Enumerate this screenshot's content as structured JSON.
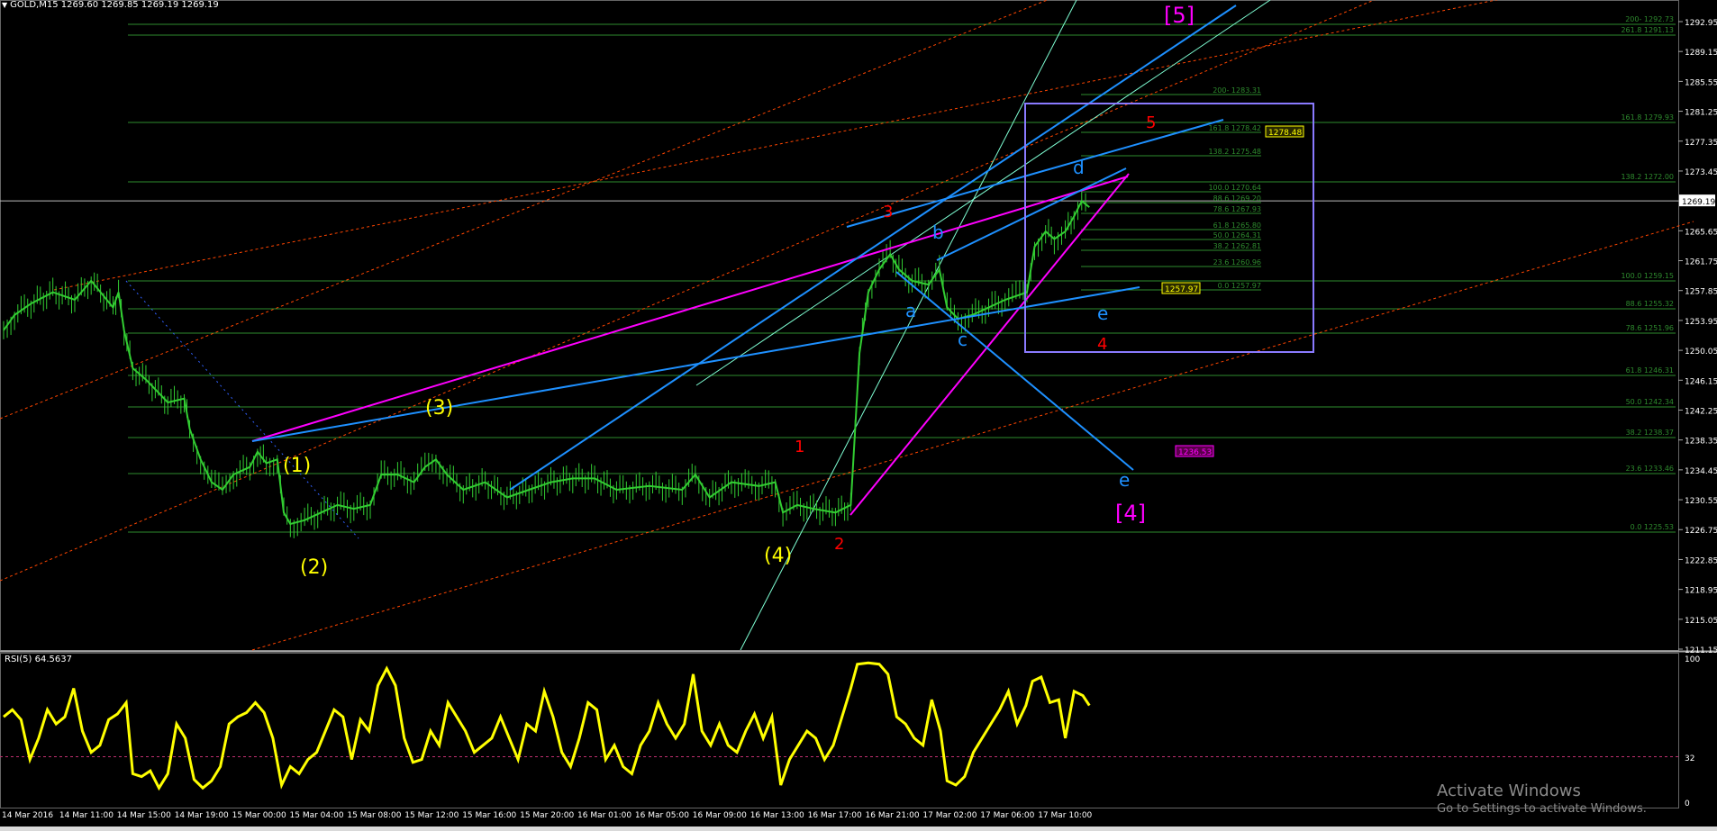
{
  "header": {
    "symbol": "GOLD,M15",
    "ohlc": "1269.60 1269.85 1269.19 1269.19"
  },
  "rsi_header": "RSI(5) 64.5637",
  "watermark": {
    "line1": "Activate Windows",
    "line2": "Go to Settings to activate Windows."
  },
  "colors": {
    "background": "#000000",
    "candles": "#32cd32",
    "rsi_line": "#ffff00",
    "fib_lines": "#2e8b2e",
    "trend_blue": "#1e90ff",
    "trend_magenta": "#ff00ff",
    "channel_red": "#ff4500",
    "channel_cyan": "#7fffd4",
    "box": "#8a7aff"
  },
  "chart_data": [
    {
      "type": "candlestick",
      "instrument": "GOLD",
      "timeframe": "M15",
      "current_price": 1269.19,
      "current_price_label": "1269.19",
      "y_ticks": [
        "1292.95",
        "1289.15",
        "1285.55",
        "1281.25",
        "1277.35",
        "1273.45",
        "1269.19",
        "1265.65",
        "1261.75",
        "1257.85",
        "1253.95",
        "1250.05",
        "1246.15",
        "1242.25",
        "1238.35",
        "1234.45",
        "1230.55",
        "1226.75",
        "1222.85",
        "1218.95",
        "1215.05",
        "1211.15"
      ],
      "x_ticks": [
        "14 Mar 2016",
        "14 Mar 11:00",
        "14 Mar 15:00",
        "14 Mar 19:00",
        "15 Mar 00:00",
        "15 Mar 04:00",
        "15 Mar 08:00",
        "15 Mar 12:00",
        "15 Mar 16:00",
        "15 Mar 20:00",
        "16 Mar 01:00",
        "16 Mar 05:00",
        "16 Mar 09:00",
        "16 Mar 13:00",
        "16 Mar 17:00",
        "16 Mar 21:00",
        "17 Mar 02:00",
        "17 Mar 06:00",
        "17 Mar 10:00"
      ],
      "price_path": [
        [
          0,
          1253
        ],
        [
          10,
          1255
        ],
        [
          25,
          1256.5
        ],
        [
          45,
          1258
        ],
        [
          65,
          1257
        ],
        [
          80,
          1259.5
        ],
        [
          100,
          1256
        ],
        [
          105,
          1258
        ],
        [
          110,
          1253
        ],
        [
          118,
          1248
        ],
        [
          130,
          1246.5
        ],
        [
          150,
          1243.5
        ],
        [
          165,
          1244
        ],
        [
          170,
          1240
        ],
        [
          180,
          1236
        ],
        [
          190,
          1233
        ],
        [
          200,
          1232
        ],
        [
          210,
          1234
        ],
        [
          225,
          1235
        ],
        [
          232,
          1237
        ],
        [
          240,
          1235.5
        ],
        [
          250,
          1236
        ],
        [
          256,
          1229
        ],
        [
          262,
          1227.5
        ],
        [
          275,
          1228
        ],
        [
          290,
          1229
        ],
        [
          305,
          1230
        ],
        [
          320,
          1229.5
        ],
        [
          335,
          1230
        ],
        [
          345,
          1234
        ],
        [
          360,
          1234
        ],
        [
          375,
          1233
        ],
        [
          385,
          1235
        ],
        [
          395,
          1236
        ],
        [
          405,
          1234
        ],
        [
          420,
          1232
        ],
        [
          440,
          1233
        ],
        [
          460,
          1231
        ],
        [
          480,
          1232
        ],
        [
          500,
          1233
        ],
        [
          520,
          1233.5
        ],
        [
          540,
          1233.5
        ],
        [
          560,
          1232
        ],
        [
          590,
          1232.5
        ],
        [
          620,
          1232
        ],
        [
          632,
          1234
        ],
        [
          645,
          1231
        ],
        [
          665,
          1233
        ],
        [
          690,
          1232.5
        ],
        [
          705,
          1233
        ],
        [
          712,
          1229
        ],
        [
          725,
          1230
        ],
        [
          740,
          1229.5
        ],
        [
          760,
          1229
        ],
        [
          774,
          1230
        ],
        [
          778,
          1240
        ],
        [
          782,
          1250
        ],
        [
          790,
          1258
        ],
        [
          800,
          1261
        ],
        [
          810,
          1263
        ],
        [
          818,
          1261
        ],
        [
          830,
          1259.5
        ],
        [
          845,
          1259
        ],
        [
          855,
          1261
        ],
        [
          862,
          1256
        ],
        [
          872,
          1254.5
        ],
        [
          885,
          1255
        ],
        [
          900,
          1256
        ],
        [
          915,
          1257
        ],
        [
          925,
          1257.5
        ],
        [
          935,
          1258
        ],
        [
          942,
          1264
        ],
        [
          952,
          1266
        ],
        [
          960,
          1265
        ],
        [
          970,
          1266
        ],
        [
          978,
          1268
        ],
        [
          985,
          1270
        ],
        [
          992,
          1269.19
        ]
      ],
      "rsi": {
        "level_labels": [
          "100",
          "32",
          "0"
        ],
        "dashed_level": 32,
        "values": [
          [
            0,
            60
          ],
          [
            8,
            65
          ],
          [
            16,
            58
          ],
          [
            24,
            30
          ],
          [
            32,
            45
          ],
          [
            40,
            65
          ],
          [
            48,
            55
          ],
          [
            56,
            60
          ],
          [
            64,
            80
          ],
          [
            72,
            50
          ],
          [
            80,
            35
          ],
          [
            88,
            40
          ],
          [
            96,
            58
          ],
          [
            104,
            62
          ],
          [
            112,
            70
          ],
          [
            118,
            20
          ],
          [
            126,
            18
          ],
          [
            134,
            22
          ],
          [
            142,
            10
          ],
          [
            150,
            20
          ],
          [
            158,
            55
          ],
          [
            166,
            45
          ],
          [
            174,
            16
          ],
          [
            182,
            10
          ],
          [
            190,
            15
          ],
          [
            198,
            25
          ],
          [
            206,
            55
          ],
          [
            214,
            60
          ],
          [
            222,
            63
          ],
          [
            230,
            70
          ],
          [
            238,
            63
          ],
          [
            246,
            45
          ],
          [
            254,
            12
          ],
          [
            262,
            25
          ],
          [
            270,
            20
          ],
          [
            278,
            30
          ],
          [
            286,
            35
          ],
          [
            294,
            50
          ],
          [
            302,
            65
          ],
          [
            310,
            60
          ],
          [
            318,
            30
          ],
          [
            326,
            58
          ],
          [
            334,
            50
          ],
          [
            342,
            82
          ],
          [
            350,
            94
          ],
          [
            358,
            82
          ],
          [
            366,
            45
          ],
          [
            374,
            28
          ],
          [
            382,
            30
          ],
          [
            390,
            50
          ],
          [
            398,
            40
          ],
          [
            406,
            70
          ],
          [
            414,
            60
          ],
          [
            422,
            50
          ],
          [
            430,
            35
          ],
          [
            438,
            40
          ],
          [
            446,
            45
          ],
          [
            454,
            60
          ],
          [
            462,
            45
          ],
          [
            470,
            30
          ],
          [
            478,
            55
          ],
          [
            486,
            50
          ],
          [
            494,
            78
          ],
          [
            502,
            60
          ],
          [
            510,
            35
          ],
          [
            518,
            25
          ],
          [
            526,
            45
          ],
          [
            534,
            70
          ],
          [
            542,
            65
          ],
          [
            550,
            30
          ],
          [
            558,
            40
          ],
          [
            566,
            25
          ],
          [
            574,
            20
          ],
          [
            582,
            40
          ],
          [
            590,
            50
          ],
          [
            598,
            70
          ],
          [
            606,
            55
          ],
          [
            614,
            45
          ],
          [
            622,
            55
          ],
          [
            630,
            90
          ],
          [
            638,
            50
          ],
          [
            646,
            40
          ],
          [
            654,
            55
          ],
          [
            662,
            40
          ],
          [
            670,
            35
          ],
          [
            678,
            50
          ],
          [
            686,
            62
          ],
          [
            694,
            45
          ],
          [
            702,
            60
          ],
          [
            710,
            12
          ],
          [
            718,
            30
          ],
          [
            726,
            40
          ],
          [
            734,
            50
          ],
          [
            742,
            45
          ],
          [
            750,
            30
          ],
          [
            758,
            40
          ],
          [
            766,
            60
          ],
          [
            774,
            80
          ],
          [
            780,
            97
          ],
          [
            790,
            98
          ],
          [
            800,
            97
          ],
          [
            808,
            90
          ],
          [
            816,
            60
          ],
          [
            824,
            55
          ],
          [
            832,
            45
          ],
          [
            840,
            40
          ],
          [
            848,
            72
          ],
          [
            856,
            50
          ],
          [
            862,
            15
          ],
          [
            870,
            12
          ],
          [
            878,
            18
          ],
          [
            886,
            35
          ],
          [
            894,
            45
          ],
          [
            902,
            55
          ],
          [
            910,
            65
          ],
          [
            918,
            78
          ],
          [
            926,
            55
          ],
          [
            934,
            68
          ],
          [
            940,
            85
          ],
          [
            948,
            88
          ],
          [
            956,
            70
          ],
          [
            964,
            72
          ],
          [
            970,
            45
          ],
          [
            978,
            78
          ],
          [
            986,
            75
          ],
          [
            992,
            68
          ]
        ]
      },
      "fib_right": [
        "200- 1292.73",
        "261.8 1291.13",
        "161.8 1279.93",
        "138.2 1272.00",
        "100.0 1259.15",
        "88.6 1255.32",
        "78.6 1251.96",
        "61.8 1246.31",
        "50.0 1242.34",
        "38.2 1238.37",
        "23.6 1233.46",
        "0.0 1225.53"
      ],
      "fib_box": [
        "200- 1283.31",
        "161.8 1278.42",
        "138.2 1275.48",
        "100.0 1270.64",
        "88.6 1269.20",
        "78.6 1267.93",
        "61.8 1265.80",
        "50.0 1264.31",
        "38.2 1262.81",
        "23.6 1260.96",
        "0.0 1257.97"
      ],
      "price_tags": [
        {
          "text": "1278.48",
          "price": 1278.48,
          "color": "#ffff00"
        },
        {
          "text": "1257.97",
          "price": 1257.97,
          "color": "#ffff00"
        },
        {
          "text": "1236.53",
          "price": 1236.53,
          "color": "#ff00ff"
        }
      ],
      "wave_labels": [
        {
          "text": "(1)",
          "color": "#ffff00"
        },
        {
          "text": "(2)",
          "color": "#ffff00"
        },
        {
          "text": "(3)",
          "color": "#ffff00"
        },
        {
          "text": "(4)",
          "color": "#ffff00"
        },
        {
          "text": "1",
          "color": "#ff0000"
        },
        {
          "text": "2",
          "color": "#ff0000"
        },
        {
          "text": "3",
          "color": "#ff0000"
        },
        {
          "text": "4",
          "color": "#ff0000"
        },
        {
          "text": "5",
          "color": "#ff0000"
        },
        {
          "text": "a",
          "color": "#1e90ff"
        },
        {
          "text": "b",
          "color": "#1e90ff"
        },
        {
          "text": "c",
          "color": "#1e90ff"
        },
        {
          "text": "d",
          "color": "#1e90ff"
        },
        {
          "text": "e",
          "color": "#1e90ff"
        },
        {
          "text": "e",
          "color": "#1e90ff"
        },
        {
          "text": "[4]",
          "color": "#ff00ff"
        },
        {
          "text": "[5]",
          "color": "#ff00ff"
        }
      ]
    }
  ]
}
